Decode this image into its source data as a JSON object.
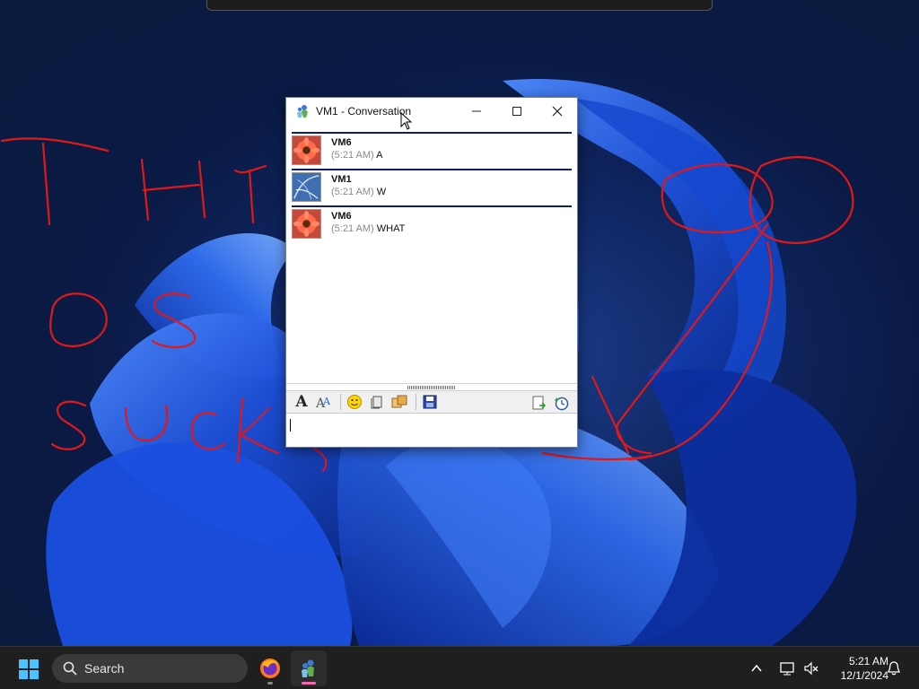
{
  "window": {
    "title": "VM1 - Conversation",
    "minimize_label": "—",
    "maximize_label": "☐",
    "close_label": "✕"
  },
  "messages": [
    {
      "sender": "VM6",
      "time": "(5:21 AM)",
      "text": "A",
      "avatar": "flower-avatar"
    },
    {
      "sender": "VM1",
      "time": "(5:21 AM)",
      "text": "W",
      "avatar": "abstract-avatar"
    },
    {
      "sender": "VM6",
      "time": "(5:21 AM)",
      "text": "WHAT",
      "avatar": "flower-avatar"
    }
  ],
  "toolbar": {
    "left": [
      "font-icon",
      "font-style-icon",
      "emoticon-icon",
      "nudge-icon",
      "wink-icon",
      "save-icon"
    ],
    "right": [
      "send-file-icon",
      "history-icon"
    ]
  },
  "input": {
    "value": ""
  },
  "taskbar": {
    "search_label": "Search",
    "apps": [
      "firefox-icon",
      "messenger-icon"
    ]
  },
  "clock": {
    "time": "5:21 AM",
    "date": "12/1/2024"
  },
  "colors": {
    "message_divider": "#0e1d6b",
    "scribble": "#e01818",
    "taskbar": "#1f1f1f"
  }
}
